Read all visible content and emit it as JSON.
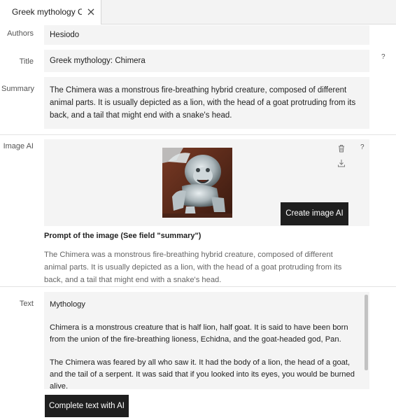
{
  "tab": {
    "title": "Greek mythology Chi..."
  },
  "fields": {
    "authors": {
      "label": "Authors",
      "value": "Hesiodo"
    },
    "title": {
      "label": "Title",
      "value": "Greek mythology: Chimera",
      "help": "?"
    },
    "summary": {
      "label": "Summary",
      "value": "The Chimera was a monstrous fire-breathing hybrid creature, composed of different animal parts. It is usually depicted as a lion, with the head of a goat protruding from its back, and a tail that might end with a snake's head."
    }
  },
  "image_ai": {
    "label": "Image AI",
    "help": "?",
    "create_button": "Create image AI",
    "prompt_title": "Prompt of the image (See field \"summary\")",
    "prompt_text": "The Chimera was a monstrous fire-breathing hybrid creature, composed of different animal parts. It is usually depicted as a lion, with the head of a goat protruding from its back, and a tail that might end with a snake's head."
  },
  "text": {
    "label": "Text",
    "heading": "Mythology",
    "paragraphs": [
      "Chimera is a monstrous creature that is half lion, half goat. It is said to have been born from the union of the fire-breathing lioness, Echidna, and the goat-headed god, Pan.",
      "The Chimera was feared by all who saw it. It had the body of a lion, the head of a goat, and the tail of a serpent. It was said that if you looked into its eyes, you would be burned alive."
    ],
    "complete_button": "Complete text with AI"
  },
  "icons": {
    "trash": "trash-icon",
    "download": "download-icon",
    "close": "close-icon"
  }
}
